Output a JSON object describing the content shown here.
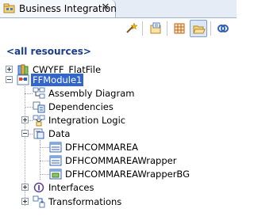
{
  "view": {
    "title": "Business Integration",
    "close_glyph": "✕",
    "icons": {
      "tab": "business-integration-icon"
    }
  },
  "toolbar": {
    "buttons": [
      {
        "name": "filter-wand-icon",
        "active": false
      },
      {
        "name": "new-module-icon",
        "active": false
      },
      {
        "name": "show-grid-icon",
        "active": false
      },
      {
        "name": "open-folder-icon",
        "active": true
      },
      {
        "name": "link-editor-icon",
        "active": false
      }
    ]
  },
  "tree": {
    "filter_label": "<all resources>",
    "items": [
      {
        "label": "CWYFF_FlatFile",
        "icon": "library-icon",
        "expander": "plus"
      },
      {
        "label": "FFModule1",
        "icon": "module-icon",
        "expander": "minus",
        "selected": true
      },
      {
        "label": "Assembly Diagram",
        "icon": "assembly-diagram-icon"
      },
      {
        "label": "Dependencies",
        "icon": "dependencies-icon"
      },
      {
        "label": "Integration Logic",
        "icon": "integration-logic-icon",
        "expander": "plus"
      },
      {
        "label": "Data",
        "icon": "data-folder-icon",
        "expander": "minus"
      },
      {
        "label": "DFHCOMMAREA",
        "icon": "business-object-icon"
      },
      {
        "label": "DFHCOMMAREAWrapper",
        "icon": "business-object-icon"
      },
      {
        "label": "DFHCOMMAREAWrapperBG",
        "icon": "business-graph-icon"
      },
      {
        "label": "Interfaces",
        "icon": "interfaces-icon",
        "expander": "plus"
      },
      {
        "label": "Transformations",
        "icon": "transformations-icon",
        "expander": "plus"
      }
    ]
  },
  "colors": {
    "selection": "#3366cc",
    "filter_label": "#1b3d8f",
    "tab_background": "#e6ecf5"
  }
}
